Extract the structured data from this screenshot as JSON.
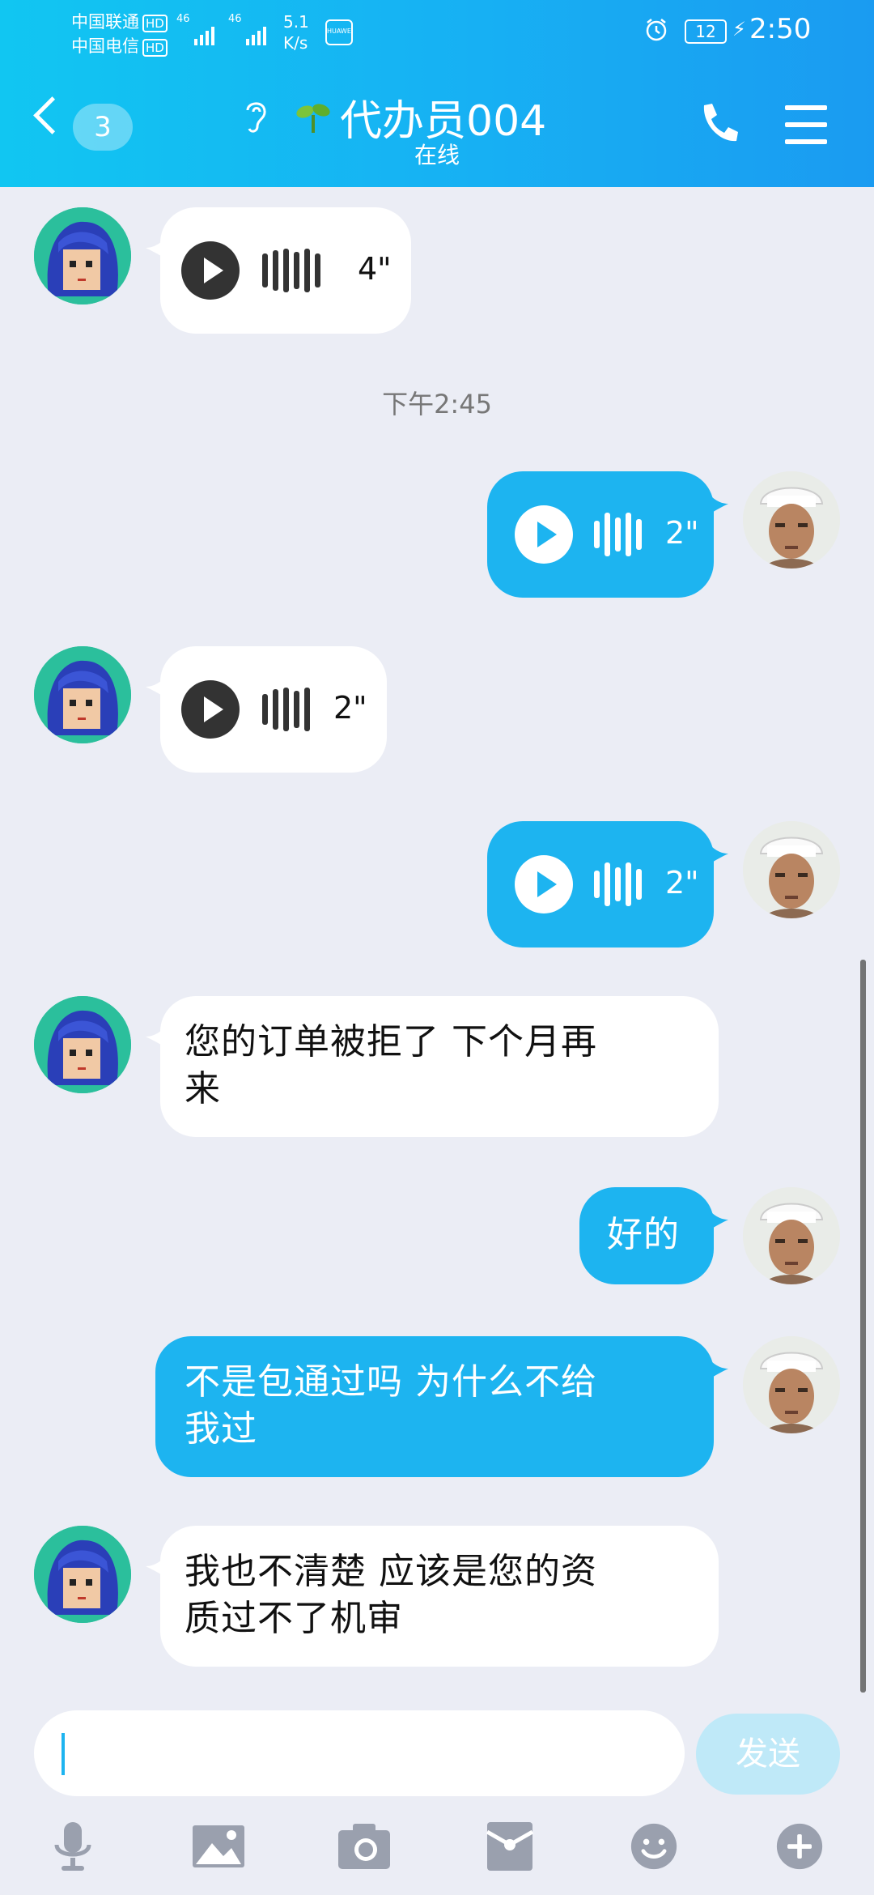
{
  "status_bar": {
    "carrier1": "中国联通",
    "carrier2": "中国电信",
    "hd": "HD",
    "net1": "46",
    "net2": "46",
    "speed_value": "5.1",
    "speed_unit": "K/s",
    "huawei": "HUAWEI",
    "battery": "12",
    "time": "2:50"
  },
  "header": {
    "unread_badge": "3",
    "title": "代办员004",
    "subtitle": "在线"
  },
  "messages": [
    {
      "side": "in",
      "type": "voice",
      "duration": "4\""
    },
    {
      "side": "time",
      "type": "timestamp",
      "text": "下午2:45"
    },
    {
      "side": "out",
      "type": "voice",
      "duration": "2\""
    },
    {
      "side": "in",
      "type": "voice",
      "duration": "2\""
    },
    {
      "side": "out",
      "type": "voice",
      "duration": "2\""
    },
    {
      "side": "in",
      "type": "text",
      "line1": "您的订单被拒了 下个月再",
      "line2": "来"
    },
    {
      "side": "out",
      "type": "text",
      "line1": "好的"
    },
    {
      "side": "out",
      "type": "text",
      "line1": "不是包通过吗  为什么不给",
      "line2": "我过"
    },
    {
      "side": "in",
      "type": "text",
      "line1": "我也不清楚  应该是您的资",
      "line2": "质过不了机审"
    }
  ],
  "input": {
    "value": "",
    "send_label": "发送"
  },
  "toolbar": [
    "microphone-icon",
    "image-icon",
    "camera-icon",
    "red-packet-icon",
    "emoji-icon",
    "plus-icon"
  ],
  "colors": {
    "header_start": "#11c6f2",
    "header_end": "#1a9bf1",
    "outgoing_bubble": "#1db4f0",
    "incoming_bubble": "#ffffff",
    "background": "#ebedf5",
    "send_button": "#bfe9f8"
  }
}
